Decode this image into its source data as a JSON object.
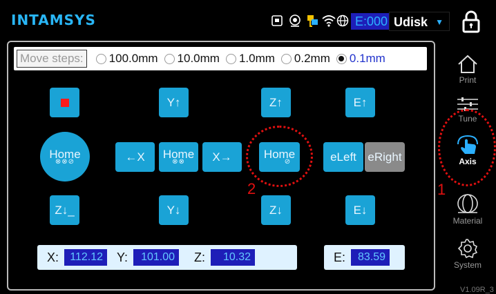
{
  "header": {
    "brand": "INTAMSYS",
    "e_counter": "E:000",
    "storage": "Udisk",
    "icons": [
      "sd-card-icon",
      "webcam-icon",
      "ethernet-icon",
      "wifi-icon",
      "globe-icon"
    ]
  },
  "move_steps": {
    "label": "Move steps:",
    "options": [
      "100.0mm",
      "10.0mm",
      "1.0mm",
      "0.2mm",
      "0.1mm"
    ],
    "selected": "0.1mm"
  },
  "buttons": {
    "y_up": "Y↑",
    "z_up": "Z↑",
    "e_up": "E↑",
    "home": "Home",
    "home_xyz_sub": "⊗⊗⊘",
    "home_xy_sub": "⊗⊗",
    "home_z_sub": "⊘",
    "x_left": "←X",
    "x_right": "X→",
    "e_left": "eLeft",
    "e_right": "eRight",
    "z_down_alt": "Z↓_",
    "y_down": "Y↓",
    "z_down": "Z↓",
    "e_down": "E↓"
  },
  "coordinates": {
    "x_label": "X:",
    "x_value": "112.12",
    "y_label": "Y:",
    "y_value": "101.00",
    "z_label": "Z:",
    "z_value": "10.32",
    "e_label": "E:",
    "e_value": "83.59"
  },
  "sidebar": {
    "items": [
      {
        "label": "Print",
        "icon": "home-icon"
      },
      {
        "label": "Tune",
        "icon": "sliders-icon"
      },
      {
        "label": "Axis",
        "icon": "touch-hand-icon"
      },
      {
        "label": "Material",
        "icon": "filament-icon"
      },
      {
        "label": "System",
        "icon": "gear-icon"
      }
    ],
    "active": "Axis",
    "version": "V1.09R_3"
  },
  "annotations": {
    "one": "1",
    "two": "2"
  },
  "colors": {
    "accent": "#1aa3d6",
    "disabled": "#8a8a8a",
    "annotation": "#e01010",
    "value_box": "#1e1eb8"
  }
}
